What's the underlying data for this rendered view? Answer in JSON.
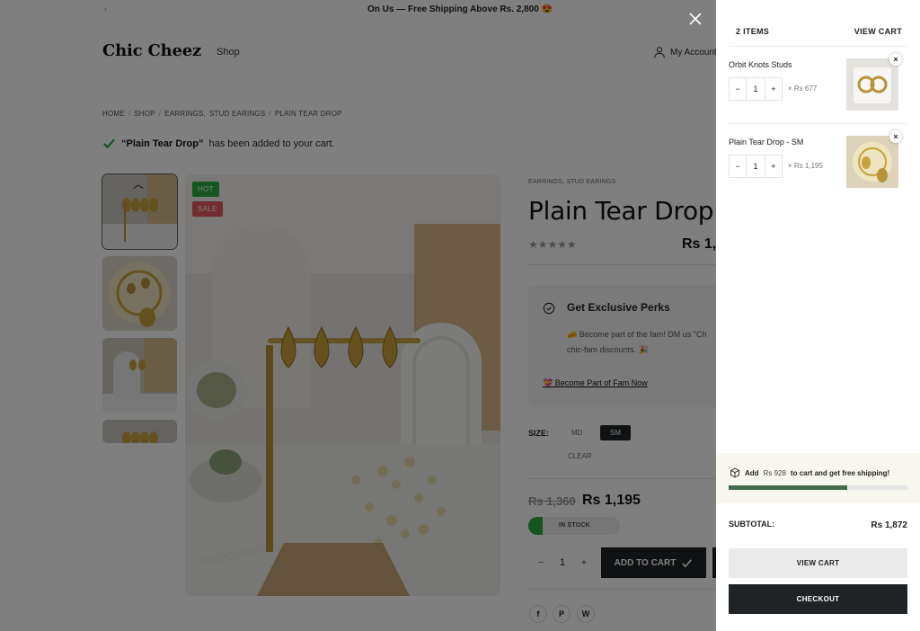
{
  "announcement": "On Us — Free Shipping Above Rs. 2,800 😍",
  "header": {
    "logo": "Chic Cheez",
    "nav_shop": "Shop",
    "account": "My Account"
  },
  "breadcrumb": [
    "HOME",
    "SHOP",
    "EARRINGS,",
    "STUD EARINGS",
    "PLAIN TEAR DROP"
  ],
  "added_message": {
    "product": "“Plain Tear Drop”",
    "suffix": "has been added to your cart."
  },
  "badges": {
    "hot": "HOT",
    "sale": "SALE"
  },
  "product": {
    "category": "EARRINGS, STUD EARINGS",
    "title": "Plain Tear Drop",
    "stars": "★★★★★",
    "price_top": "Rs 1,",
    "perks_title": "Get Exclusive Perks",
    "perks_text": "🧀 Become part of the fam! DM us \"Ch chic-fam discounts. 🎉",
    "perks_link": "💝 Become Part of Fam Now",
    "size_label": "SIZE:",
    "sizes": [
      "MD",
      "SM"
    ],
    "size_selected": "SM",
    "clear": "CLEAR",
    "price_old": "Rs 1,360",
    "price_new": "Rs 1,195",
    "stock": "IN STOCK",
    "quantity": "1",
    "add_to_cart": "ADD TO CART",
    "social": [
      "f",
      "P",
      "W"
    ]
  },
  "cart": {
    "count": "2 ITEMS",
    "view_cart_link": "VIEW CART",
    "items": [
      {
        "name": "Orbit Knots Studs",
        "qty": "1",
        "price": "× Rs 677"
      },
      {
        "name": "Plain Tear Drop - SM",
        "qty": "1",
        "price": "× Rs 1,195"
      }
    ],
    "shipping_prefix": "Add",
    "shipping_amount": "Rs 928",
    "shipping_suffix": "to cart and get free shipping!",
    "shipping_progress": 0.665,
    "subtotal_label": "SUBTOTAL:",
    "subtotal_value": "Rs 1,872",
    "view_cart_button": "VIEW CART",
    "checkout_button": "CHECKOUT"
  },
  "colors": {
    "accent_dark": "#1f2326",
    "success_green": "#2aaa3e",
    "sale_red": "#e35b5b",
    "progress_green": "#45694b"
  }
}
